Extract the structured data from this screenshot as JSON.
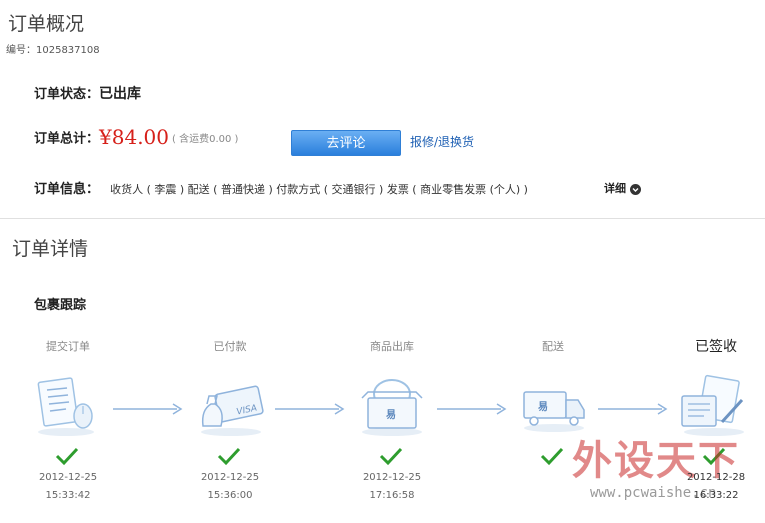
{
  "overview": {
    "title": "订单概况",
    "order_no_label": "编号：",
    "order_no": "1025837108"
  },
  "status": {
    "label": "订单状态：",
    "value": "已出库"
  },
  "total": {
    "label": "订单总计：",
    "amount": "¥84.00",
    "note": "( 含运费0.00 )",
    "review_button": "去评论",
    "repair_link": "报修/退换货"
  },
  "info": {
    "label": "订单信息：",
    "text": "收货人 ( 李震 )  配送 ( 普通快递 )  付款方式 ( 交通银行 )  发票 ( 商业零售发票 (个人) )",
    "detail_link": "详细"
  },
  "details": {
    "title": "订单详情",
    "tracking_title": "包裹跟踪"
  },
  "steps": [
    {
      "label": "提交订单",
      "date": "2012-12-25",
      "time": "15:33:42",
      "icon": "order-form-icon"
    },
    {
      "label": "已付款",
      "date": "2012-12-25",
      "time": "15:36:00",
      "icon": "bank-card-icon"
    },
    {
      "label": "商品出库",
      "date": "2012-12-25",
      "time": "17:16:58",
      "icon": "package-box-icon"
    },
    {
      "label": "配送",
      "date": "",
      "time": "",
      "icon": "delivery-truck-icon"
    },
    {
      "label": "已签收",
      "date": "2012-12-28",
      "time": "16:33:22",
      "icon": "signed-document-icon"
    }
  ],
  "watermark": {
    "brand": "外设天下",
    "url": "www.pcwaishe.cn"
  },
  "colors": {
    "price": "#d6201a",
    "button": "#2a7fdc",
    "link": "#1d5fb3",
    "check": "#2e9d2e",
    "arrow": "#8fb3dc"
  }
}
